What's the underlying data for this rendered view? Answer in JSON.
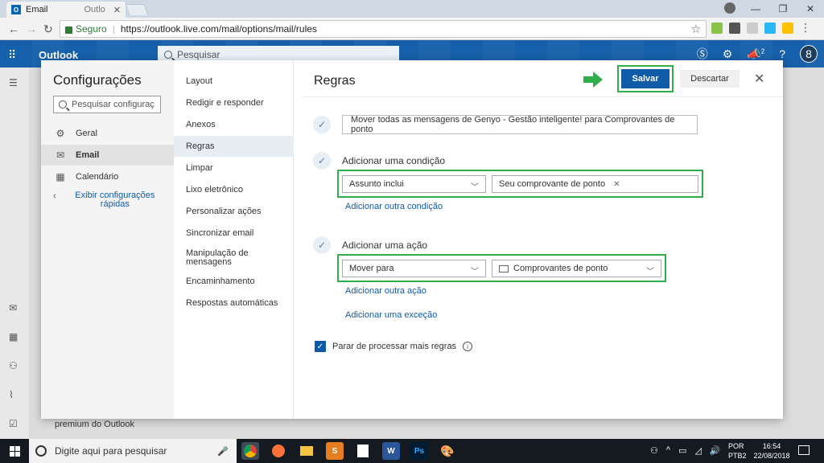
{
  "browser": {
    "tab_title": "Email",
    "tab_title_secondary": "Outlo",
    "secure_label": "Seguro",
    "url": "https://outlook.live.com/mail/options/mail/rules"
  },
  "outlook": {
    "brand": "Outlook",
    "search_placeholder": "Pesquisar",
    "avatar_initial": "8",
    "notif_count": "2",
    "promo_text": "premium do Outlook"
  },
  "settings": {
    "title": "Configurações",
    "search_placeholder": "Pesquisar configuraç...",
    "categories": [
      "Geral",
      "Email",
      "Calendário"
    ],
    "quick_settings": "Exibir configurações rápidas"
  },
  "email_menu": {
    "items": [
      "Layout",
      "Redigir e responder",
      "Anexos",
      "Regras",
      "Limpar",
      "Lixo eletrônico",
      "Personalizar ações",
      "Sincronizar email",
      "Manipulação de mensagens",
      "Encaminhamento",
      "Respostas automáticas"
    ]
  },
  "rules": {
    "title": "Regras",
    "save_label": "Salvar",
    "discard_label": "Descartar",
    "rule_name": "Mover todas as mensagens de Genyo - Gestão inteligente! para Comprovantes de ponto",
    "condition_label": "Adicionar uma condição",
    "condition_select": "Assunto inclui",
    "condition_value": "Seu comprovante de ponto",
    "add_condition_link": "Adicionar outra condição",
    "action_label": "Adicionar uma ação",
    "action_select": "Mover para",
    "action_folder": "Comprovantes de ponto",
    "add_action_link": "Adicionar outra ação",
    "add_exception_link": "Adicionar uma exceção",
    "stop_processing": "Parar de processar mais regras"
  },
  "taskbar": {
    "search_placeholder": "Digite aqui para pesquisar",
    "lang_1": "POR",
    "lang_2": "PTB2",
    "time": "16:54",
    "date": "22/08/2018"
  },
  "colors": {
    "accent": "#0f5ba8",
    "highlight_box": "#2fae4c"
  }
}
